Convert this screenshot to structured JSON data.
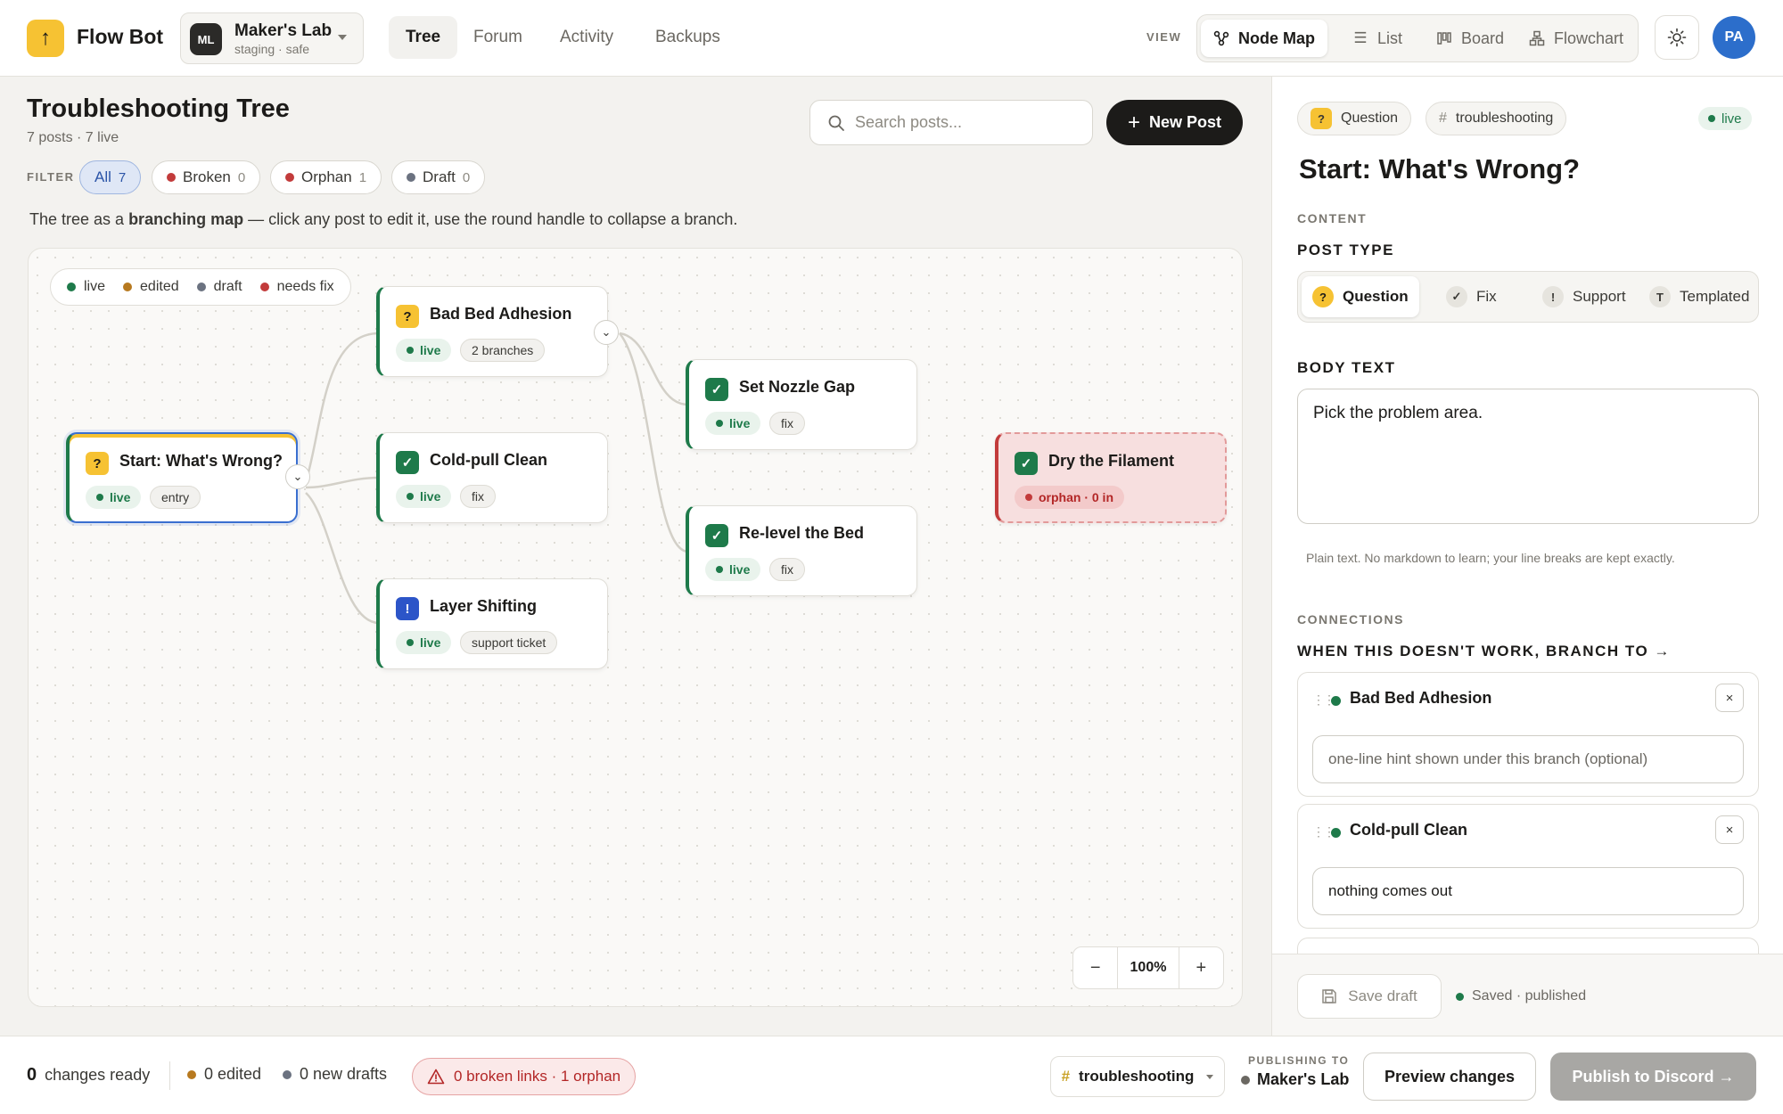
{
  "app": {
    "name": "Flow Bot",
    "logo_glyph": "↑"
  },
  "workspace": {
    "initials": "ML",
    "name": "Maker's Lab",
    "subtitle": "staging · safe"
  },
  "nav": {
    "tabs": [
      "Tree",
      "Forum",
      "Activity",
      "Backups"
    ],
    "active": "Tree"
  },
  "view": {
    "label": "VIEW",
    "options": [
      {
        "label": "Node Map",
        "icon": "node-map-icon",
        "active": true
      },
      {
        "label": "List",
        "icon": "list-icon",
        "active": false
      },
      {
        "label": "Board",
        "icon": "board-icon",
        "active": false
      },
      {
        "label": "Flowchart",
        "icon": "flowchart-icon",
        "active": false
      }
    ]
  },
  "user": {
    "initials": "PA"
  },
  "main": {
    "title": "Troubleshooting Tree",
    "subtitle": "7 posts · 7 live",
    "search_placeholder": "Search posts...",
    "new_post_label": "New Post",
    "filter_label": "FILTER",
    "filters": [
      {
        "label": "All",
        "count": "7",
        "active": true
      },
      {
        "label": "Broken",
        "count": "0",
        "color": "#c23b3b"
      },
      {
        "label": "Orphan",
        "count": "1",
        "color": "#c23b3b"
      },
      {
        "label": "Draft",
        "count": "0",
        "color": "#6b7280"
      }
    ],
    "description_pre": "The tree as a ",
    "description_bold": "branching map",
    "description_post": " — click any post to edit it, use the round handle to collapse a branch."
  },
  "legend": [
    {
      "label": "live",
      "color": "#1e7a4a"
    },
    {
      "label": "edited",
      "color": "#b7791f"
    },
    {
      "label": "draft",
      "color": "#6b7280"
    },
    {
      "label": "needs fix",
      "color": "#c23b3b"
    }
  ],
  "nodes": [
    {
      "title": "Start: What's Wrong?",
      "type": "question",
      "status": "live",
      "tag": "entry"
    },
    {
      "title": "Bad Bed Adhesion",
      "type": "question",
      "status": "live",
      "tag": "2 branches"
    },
    {
      "title": "Cold-pull Clean",
      "type": "fix",
      "status": "live",
      "tag": "fix"
    },
    {
      "title": "Layer Shifting",
      "type": "support",
      "status": "live",
      "tag": "support ticket"
    },
    {
      "title": "Set Nozzle Gap",
      "type": "fix",
      "status": "live",
      "tag": "fix"
    },
    {
      "title": "Re-level the Bed",
      "type": "fix",
      "status": "live",
      "tag": "fix"
    },
    {
      "title": "Dry the Filament",
      "type": "fix",
      "status": "orphan · 0 in",
      "tag": ""
    }
  ],
  "zoom": {
    "value": "100%",
    "minus": "−",
    "plus": "+"
  },
  "editor": {
    "type_tag": "Question",
    "channel_tag": "troubleshooting",
    "status": "live",
    "title": "Start: What's Wrong?",
    "content_label": "CONTENT",
    "post_type_label": "POST TYPE",
    "post_types": [
      {
        "label": "Question",
        "glyph": "?",
        "active": true
      },
      {
        "label": "Fix",
        "glyph": "✓",
        "active": false
      },
      {
        "label": "Support",
        "glyph": "!",
        "active": false
      },
      {
        "label": "Templated",
        "glyph": "T",
        "active": false
      }
    ],
    "body_label": "BODY TEXT",
    "body_text": "Pick the problem area.",
    "body_hint": "Plain text. No markdown to learn; your line breaks are kept exactly.",
    "connections_label": "CONNECTIONS",
    "branch_label": "WHEN THIS DOESN'T WORK, BRANCH TO →",
    "connections": [
      {
        "name": "Bad Bed Adhesion",
        "hint_value": "",
        "hint_placeholder": "one-line hint shown under this branch (optional)"
      },
      {
        "name": "Cold-pull Clean",
        "hint_value": "nothing comes out",
        "hint_placeholder": "one-line hint shown under this branch (optional)"
      }
    ],
    "save_draft_label": "Save draft",
    "saved_status": "Saved · published"
  },
  "bottom": {
    "changes_count": "0",
    "changes_label": "changes ready",
    "edited": "0 edited",
    "new_drafts": "0 new drafts",
    "warning": "0 broken links · 1 orphan",
    "channel": "troubleshooting",
    "publishing_to_label": "PUBLISHING TO",
    "publishing_to": "Maker's Lab",
    "preview_label": "Preview changes",
    "publish_label": "Publish to Discord →"
  }
}
